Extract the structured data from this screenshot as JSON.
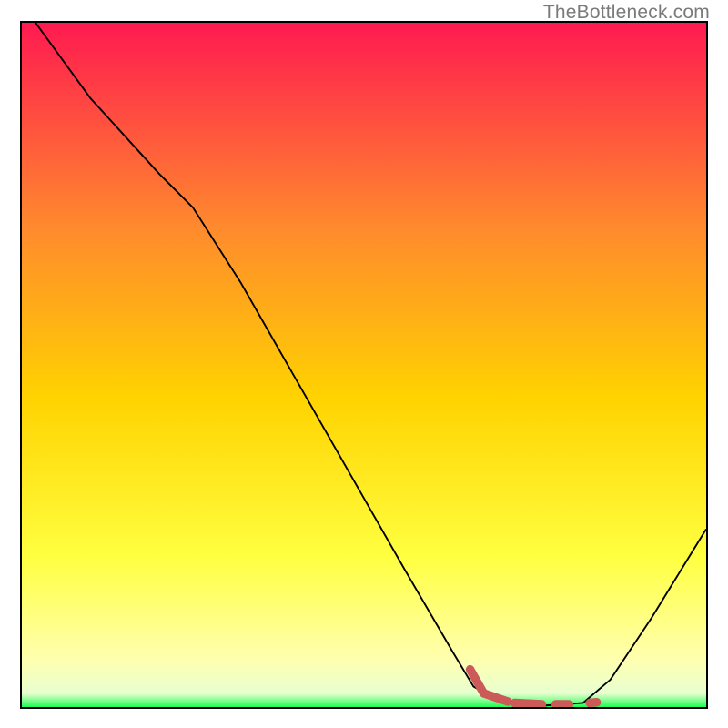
{
  "watermark": "TheBottleneck.com",
  "gradient_colors": {
    "top": "#ff1a50",
    "upper_mid": "#ff8a2d",
    "mid": "#ffd300",
    "lower_mid": "#ffff40",
    "near_bottom": "#ffffaf",
    "bottom_green": "#1dff53"
  },
  "chart_data": {
    "type": "line",
    "title": "",
    "xlabel": "",
    "ylabel": "",
    "xlim": [
      0,
      100
    ],
    "ylim": [
      0,
      100
    ],
    "series": [
      {
        "name": "bottleneck-curve",
        "color": "#000000",
        "width": 1.5,
        "points": [
          {
            "x": 2,
            "y": 100
          },
          {
            "x": 10,
            "y": 89
          },
          {
            "x": 20,
            "y": 78
          },
          {
            "x": 25,
            "y": 73
          },
          {
            "x": 32,
            "y": 62
          },
          {
            "x": 40,
            "y": 48
          },
          {
            "x": 48,
            "y": 34
          },
          {
            "x": 56,
            "y": 20
          },
          {
            "x": 63,
            "y": 8
          },
          {
            "x": 66,
            "y": 3
          },
          {
            "x": 70,
            "y": 0.6
          },
          {
            "x": 76,
            "y": 0.2
          },
          {
            "x": 82,
            "y": 0.6
          },
          {
            "x": 86,
            "y": 4
          },
          {
            "x": 92,
            "y": 13
          },
          {
            "x": 100,
            "y": 26
          }
        ]
      },
      {
        "name": "highlight-dashes",
        "color": "#cc5a58",
        "width": 9,
        "segments": [
          [
            {
              "x": 65.5,
              "y": 5.5
            },
            {
              "x": 67.5,
              "y": 2.0
            }
          ],
          [
            {
              "x": 67.5,
              "y": 2.0
            },
            {
              "x": 71.0,
              "y": 0.8
            }
          ],
          [
            {
              "x": 72.0,
              "y": 0.6
            },
            {
              "x": 76.0,
              "y": 0.4
            }
          ],
          [
            {
              "x": 78.0,
              "y": 0.4
            },
            {
              "x": 80.0,
              "y": 0.4
            }
          ],
          [
            {
              "x": 83.0,
              "y": 0.6
            },
            {
              "x": 84.0,
              "y": 0.7
            }
          ]
        ]
      }
    ]
  }
}
